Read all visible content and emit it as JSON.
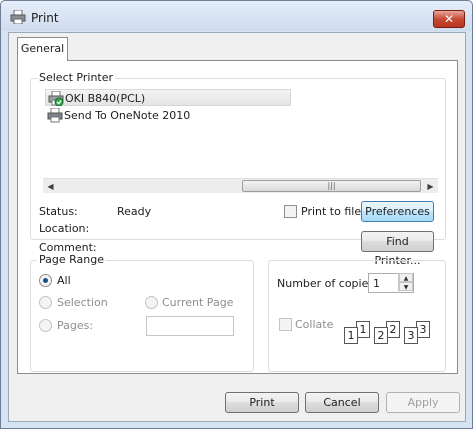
{
  "window": {
    "title": "Print",
    "close_label": "✕"
  },
  "tabs": [
    {
      "label": "General"
    }
  ],
  "select_printer": {
    "legend": "Select Printer",
    "printers": [
      {
        "name": "OKI B840(PCL)",
        "icon": "printer-default-icon",
        "selected": true
      },
      {
        "name": "Send To OneNote 2010",
        "icon": "printer-icon",
        "selected": false
      }
    ],
    "status_label": "Status:",
    "status_value": "Ready",
    "location_label": "Location:",
    "location_value": "",
    "comment_label": "Comment:",
    "comment_value": "",
    "print_to_file_label": "Print to file",
    "print_to_file_checked": false,
    "preferences_label": "Preferences",
    "find_printer_label": "Find Printer..."
  },
  "page_range": {
    "legend": "Page Range",
    "all_label": "All",
    "selection_label": "Selection",
    "current_page_label": "Current Page",
    "pages_label": "Pages:",
    "pages_value": "",
    "selected_option": "All"
  },
  "copies": {
    "label": "Number of copies:",
    "value": "1",
    "collate_label": "Collate",
    "collate_checked": false,
    "collate_pages": [
      "1",
      "1",
      "2",
      "2",
      "3",
      "3"
    ]
  },
  "buttons": {
    "print_label": "Print",
    "cancel_label": "Cancel",
    "apply_label": "Apply"
  }
}
